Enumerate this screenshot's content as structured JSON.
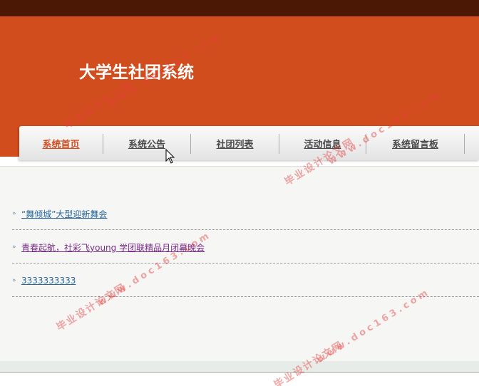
{
  "site": {
    "title": "大学生社团系统"
  },
  "nav": {
    "items": [
      {
        "label": "系统首页",
        "active": true
      },
      {
        "label": "系统公告",
        "active": false
      },
      {
        "label": "社团列表",
        "active": false
      },
      {
        "label": "活动信息",
        "active": false
      },
      {
        "label": "系统留言板",
        "active": false
      }
    ]
  },
  "news": {
    "bullet_icon": "double-chevron-right-icon",
    "items": [
      {
        "title": "“舞倾城”大型迎新舞会"
      },
      {
        "title": "青春起航，社彩飞young 学团联精品月闭幕晚会"
      },
      {
        "title": "3333333333"
      }
    ]
  },
  "watermark": {
    "line1": "毕业设计论文网",
    "line2": "www.doc163.com"
  },
  "colors": {
    "topbar": "#4c1806",
    "banner": "#d24d1e",
    "nav_active": "#d24d1e",
    "link": "#2867a0",
    "link_visited": "#7a2b8a"
  }
}
